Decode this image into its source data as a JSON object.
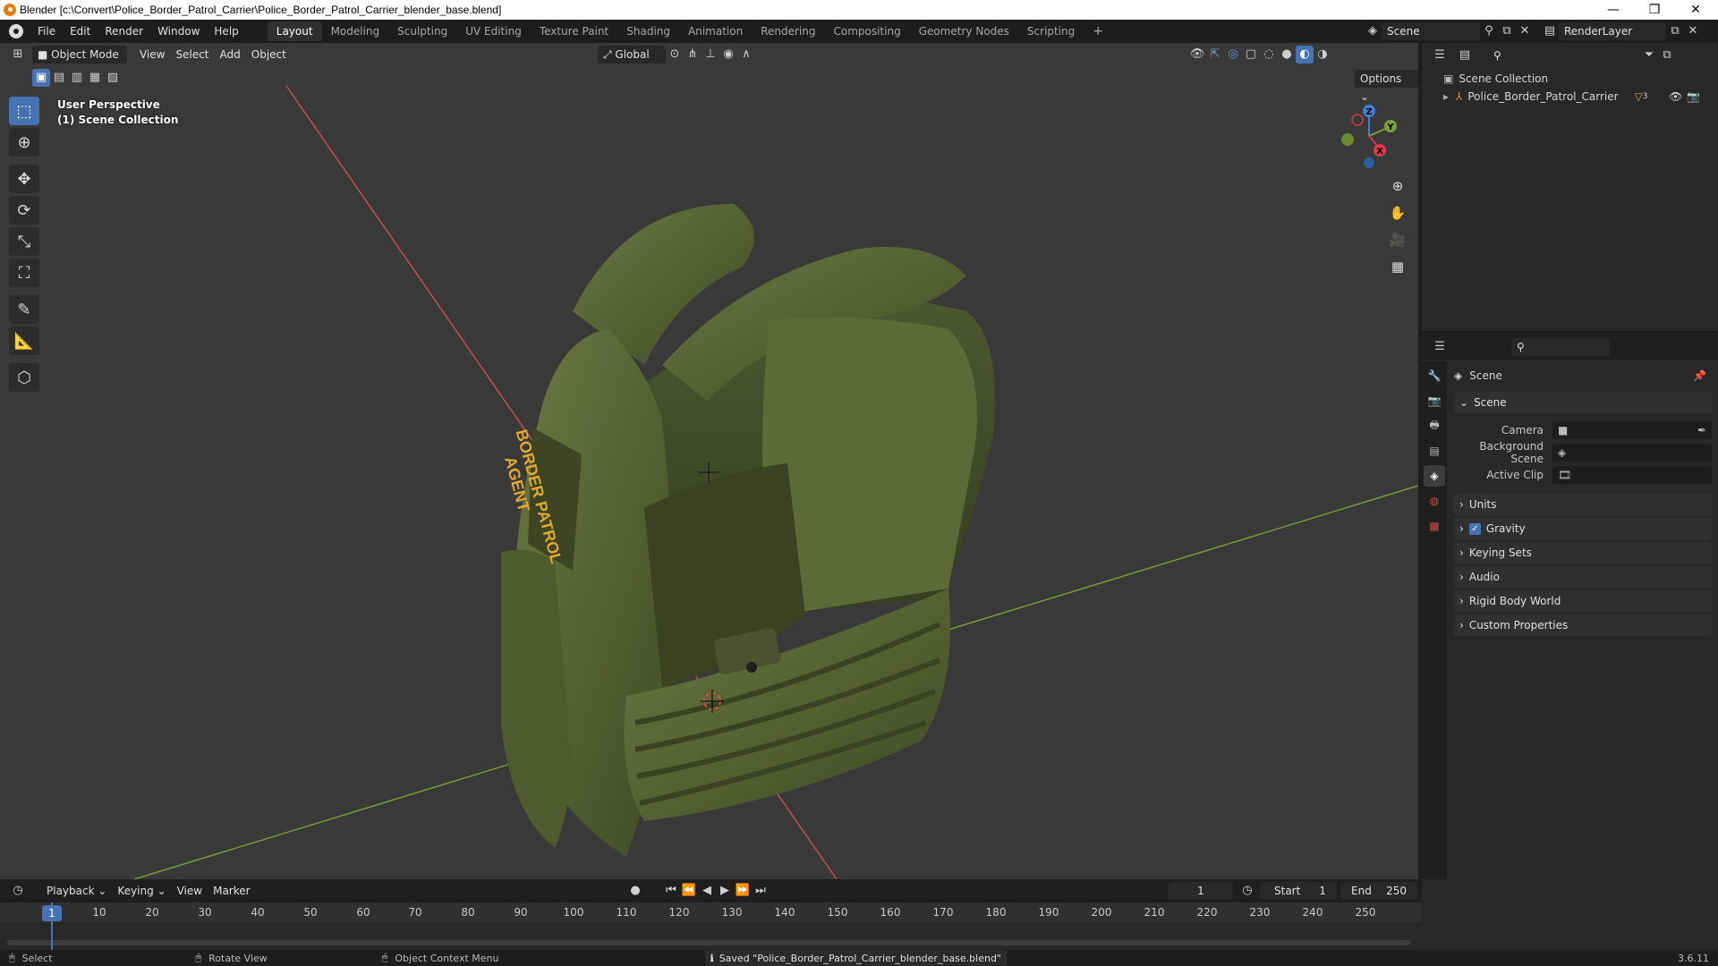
{
  "window": {
    "title": "Blender [c:\\Convert\\Police_Border_Patrol_Carrier\\Police_Border_Patrol_Carrier_blender_base.blend]",
    "controls": [
      "—",
      "❐",
      "✕"
    ]
  },
  "menu": [
    "File",
    "Edit",
    "Render",
    "Window",
    "Help"
  ],
  "workspaces": {
    "active": "Layout",
    "tabs": [
      "Layout",
      "Modeling",
      "Sculpting",
      "UV Editing",
      "Texture Paint",
      "Shading",
      "Animation",
      "Rendering",
      "Compositing",
      "Geometry Nodes",
      "Scripting"
    ],
    "add": "+"
  },
  "scene_field": "Scene",
  "render_layer_field": "RenderLayer",
  "viewport": {
    "mode": "Object Mode",
    "menus": [
      "View",
      "Select",
      "Add",
      "Object"
    ],
    "transform_orientation": "Global",
    "options_label": "Options",
    "overlay_line1": "User Perspective",
    "overlay_line2": "(1) Scene Collection",
    "vest_label_line1": "BORDER PATROL",
    "vest_label_line2": "AGENT",
    "gizmo_axes": {
      "x": "X",
      "y": "Y",
      "z": "Z"
    }
  },
  "outliner": {
    "root": "Scene Collection",
    "items": [
      {
        "name": "Police_Border_Patrol_Carrier",
        "badge": "3"
      }
    ]
  },
  "properties": {
    "header_title": "Scene",
    "panel_scene": "Scene",
    "fields": [
      {
        "label": "Camera",
        "value": ""
      },
      {
        "label": "Background Scene",
        "value": ""
      },
      {
        "label": "Active Clip",
        "value": ""
      }
    ],
    "subpanels": [
      "Units",
      "Gravity",
      "Keying Sets",
      "Audio",
      "Rigid Body World",
      "Custom Properties"
    ],
    "gravity_checked": true
  },
  "timeline": {
    "menus": [
      "Playback",
      "Keying",
      "View",
      "Marker"
    ],
    "current_frame": "1",
    "start_label": "Start",
    "start_value": "1",
    "end_label": "End",
    "end_value": "250",
    "ticks": [
      "1",
      "10",
      "20",
      "30",
      "40",
      "50",
      "60",
      "70",
      "80",
      "90",
      "100",
      "110",
      "120",
      "130",
      "140",
      "150",
      "160",
      "170",
      "180",
      "190",
      "200",
      "210",
      "220",
      "230",
      "240",
      "250"
    ]
  },
  "statusbar": {
    "select": "Select",
    "rotate": "Rotate View",
    "context": "Object Context Menu",
    "message": "Saved \"Police_Border_Patrol_Carrier_blender_base.blend\"",
    "version": "3.6.11"
  },
  "colors": {
    "accent": "#4772b3",
    "vest": "#4f5a2e",
    "x_axis": "#e2354c",
    "y_axis": "#7ca233",
    "z_axis": "#3b80d9"
  }
}
